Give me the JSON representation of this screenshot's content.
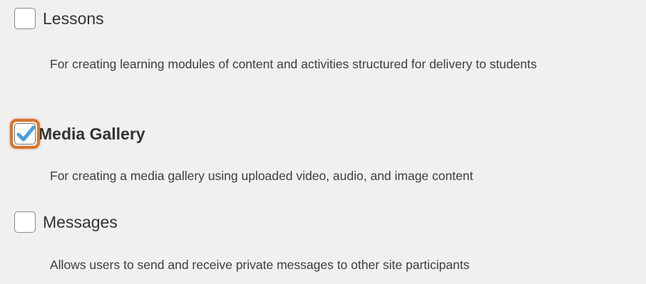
{
  "tools": [
    {
      "name": "Lessons",
      "checked": false,
      "description": "For creating learning modules of content and activities structured for delivery to students"
    },
    {
      "name": "Media Gallery",
      "checked": true,
      "description": "For creating a media gallery using uploaded video, audio, and image content"
    },
    {
      "name": "Messages",
      "checked": false,
      "description": "Allows users to send and receive private messages to other site participants"
    }
  ],
  "colors": {
    "background": "#f0f0f0",
    "highlight_ring": "#d9742b",
    "checkmark": "#4a9fdc"
  },
  "icons": {
    "checkmark": "checkmark-icon"
  }
}
